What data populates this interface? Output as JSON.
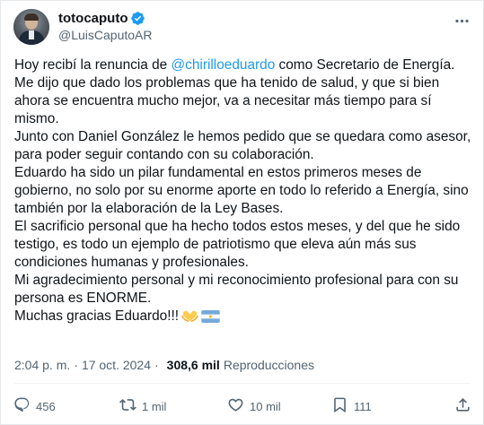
{
  "author": {
    "display_name": "totocaputo",
    "handle": "@LuisCaputoAR",
    "verified_color": "#1d9bf0"
  },
  "tweet": {
    "intro": "Hoy recibí la renuncia de ",
    "mention": "@chirilloeduardo",
    "intro_rest": " como Secretario de Energía.",
    "p1": "Me dijo que dado los problemas que ha tenido de salud, y que si bien ahora se encuentra mucho mejor, va a necesitar más tiempo para sí mismo.",
    "p2": "Junto con Daniel González le hemos pedido que se quedara como asesor, para poder seguir contando con su colaboración.",
    "p3": "Eduardo ha sido un pilar fundamental en estos primeros meses de gobierno, no solo por su enorme aporte en todo lo referido a Energía, sino también por la elaboración de la Ley Bases.",
    "p4": "El sacrificio personal que ha hecho todos estos meses, y del que he sido testigo, es todo un ejemplo de patriotismo que eleva aún más sus condiciones humanas y profesionales.",
    "p5": "Mi agradecimiento personal y mi reconocimiento profesional para con su persona es ENORME.",
    "p6": "Muchas gracias Eduardo!!!",
    "emojis": [
      "yellow-heart-hands-icon",
      "argentina-flag-icon"
    ]
  },
  "meta": {
    "time": "2:04 p. m.",
    "separator": "·",
    "date": "17 oct. 2024",
    "views_count": "308,6 mil",
    "views_label": "Reproducciones"
  },
  "actions": {
    "replies": "456",
    "reposts": "1 mil",
    "likes": "10 mil",
    "bookmarks": "111"
  },
  "colors": {
    "accent": "#1d9bf0",
    "text": "#0f1419",
    "secondary": "#536471"
  }
}
